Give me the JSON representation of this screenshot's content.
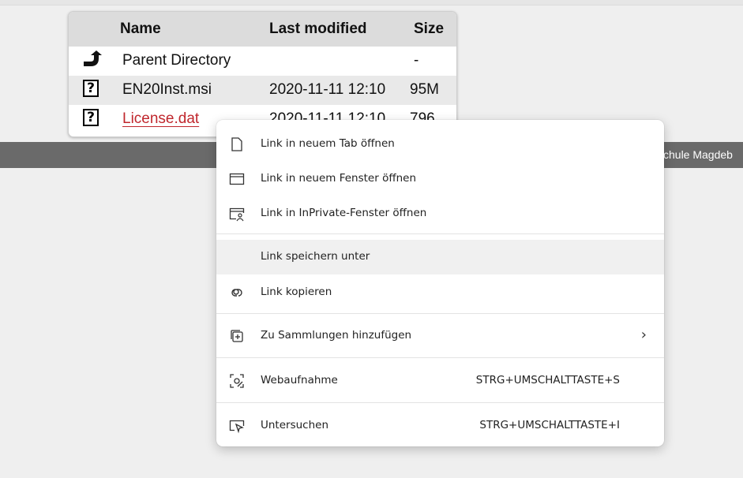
{
  "footer": {
    "text": "chule Magdeb"
  },
  "table": {
    "headers": {
      "name": "Name",
      "modified": "Last modified",
      "size": "Size"
    },
    "rows": [
      {
        "icon": "back-arrow-icon",
        "name": "Parent Directory",
        "modified": "",
        "size": "-"
      },
      {
        "icon": "unknown-file-icon",
        "name": "EN20Inst.msi",
        "modified": "2020-11-11 12:10",
        "size": "95M"
      },
      {
        "icon": "unknown-file-icon",
        "name": "License.dat",
        "modified": "2020-11-11 12:10",
        "size": "796"
      }
    ],
    "link_color": "#c0272d"
  },
  "context_menu": {
    "items": [
      {
        "label": "Link in neuem Tab öffnen",
        "icon": "new-tab-icon",
        "shortcut": ""
      },
      {
        "label": "Link in neuem Fenster öffnen",
        "icon": "new-window-icon",
        "shortcut": ""
      },
      {
        "label": "Link in InPrivate-Fenster öffnen",
        "icon": "inprivate-window-icon",
        "shortcut": ""
      },
      {
        "label": "Link speichern unter",
        "icon": "",
        "shortcut": ""
      },
      {
        "label": "Link kopieren",
        "icon": "link-icon",
        "shortcut": ""
      },
      {
        "label": "Zu Sammlungen hinzufügen",
        "icon": "collections-add-icon",
        "shortcut": "",
        "submenu": true
      },
      {
        "label": "Webaufnahme",
        "icon": "web-capture-icon",
        "shortcut": "STRG+UMSCHALTTASTE+S"
      },
      {
        "label": "Untersuchen",
        "icon": "inspect-icon",
        "shortcut": "STRG+UMSCHALTTASTE+I"
      }
    ],
    "highlighted_item": "Link speichern unter"
  }
}
